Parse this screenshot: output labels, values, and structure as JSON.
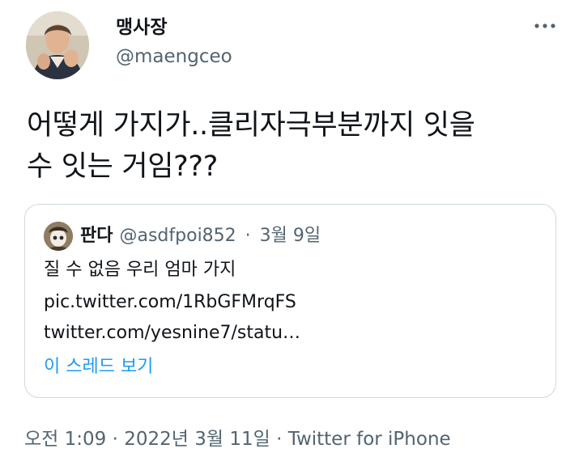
{
  "author": {
    "display_name": "맹사장",
    "handle": "@maengceo",
    "avatar_icon": "user-avatar-photo"
  },
  "more_icon": "more-horizontal-icon",
  "tweet": {
    "text_lines": [
      "어떻게 가지가..클리자극부분까지 잇을",
      "수 잇는 거임???"
    ]
  },
  "quoted_tweet": {
    "display_name": "판다",
    "handle": "@asdfpoi852",
    "separator": "·",
    "date": "3월 9일",
    "text_lines": [
      "질 수 없음 우리 엄마 가지",
      "pic.twitter.com/1RbGFMrqFS",
      "twitter.com/yesnine7/statu…"
    ],
    "show_thread": "이 스레드 보기",
    "avatar_icon": "quoted-user-avatar"
  },
  "footer": {
    "time": "오전 1:09",
    "sep1": "·",
    "date": "2022년 3월 11일",
    "sep2": "·",
    "source": "Twitter for iPhone"
  },
  "colors": {
    "text": "#0f1419",
    "secondary": "#536471",
    "link": "#1d9bf0",
    "border": "#cfd9de"
  }
}
